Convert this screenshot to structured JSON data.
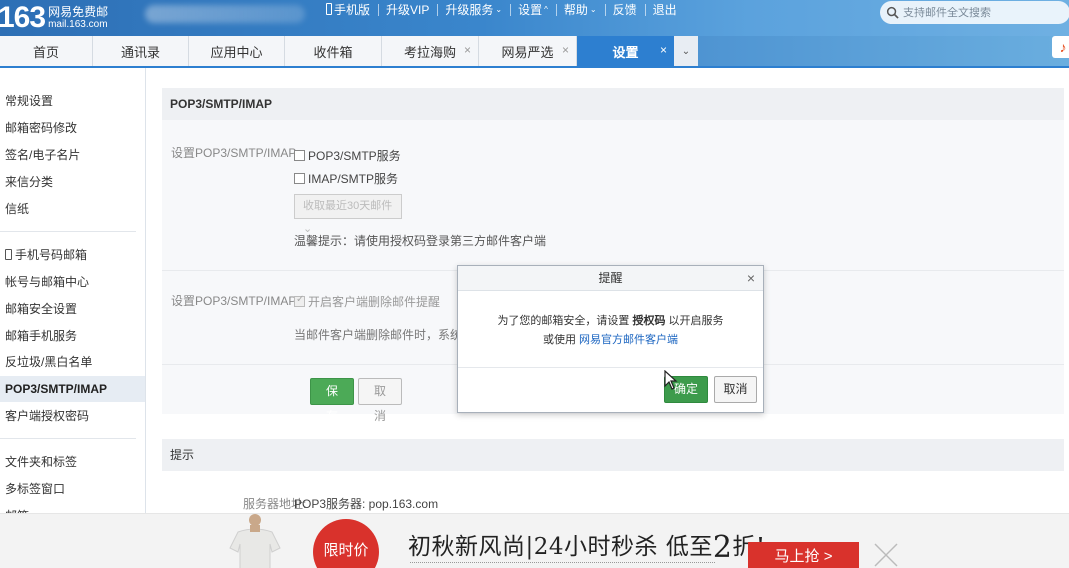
{
  "header": {
    "logo_number": "163",
    "logo_line1": "网易免费邮",
    "logo_line2": "mail.163.com",
    "links": [
      "手机版",
      "升级VIP",
      "升级服务",
      "设置",
      "帮助",
      "反馈",
      "退出"
    ],
    "search_placeholder": "支持邮件全文搜索"
  },
  "tabs": [
    {
      "label": "首页"
    },
    {
      "label": "通讯录"
    },
    {
      "label": "应用中心"
    },
    {
      "label": "收件箱"
    },
    {
      "label": "考拉海购"
    },
    {
      "label": "网易严选"
    },
    {
      "label": "设置"
    }
  ],
  "tab_close_glyph": "×",
  "tab_more_glyph": "⌄",
  "music_glyph": "♪",
  "sidebar": {
    "items": [
      "常规设置",
      "邮箱密码修改",
      "签名/电子名片",
      "来信分类",
      "信纸",
      "手机号码邮箱",
      "帐号与邮箱中心",
      "邮箱安全设置",
      "邮箱手机服务",
      "反垃圾/黑白名单",
      "POP3/SMTP/IMAP",
      "客户端授权密码",
      "文件夹和标签",
      "多标签窗口",
      "邮箱"
    ]
  },
  "main": {
    "section1_title": "POP3/SMTP/IMAP",
    "row1_label": "设置POP3/SMTP/IMAP:",
    "opt_pop3": "POP3/SMTP服务",
    "opt_imap": "IMAP/SMTP服务",
    "select_value": "收取最近30天邮件 ⌄",
    "tip": "温馨提示：请使用授权码登录第三方邮件客户端",
    "row2_label": "设置POP3/SMTP/IMAP:",
    "opt_delete": "开启客户端删除邮件提醒",
    "delete_desc": "当邮件客户端删除邮件时，系统会",
    "save_label": "保存",
    "cancel_label": "取消",
    "section2_title": "提示",
    "server_label": "服务器地址:",
    "server_value": "POP3服务器: pop.163.com"
  },
  "modal": {
    "title": "提醒",
    "close": "×",
    "msg_part1": "为了您的邮箱安全，请设置 ",
    "msg_strong": "授权码",
    "msg_part2": " 以开启服务",
    "msg2_prefix": "或使用 ",
    "msg2_link": "网易官方邮件客户端",
    "ok_label": "确定",
    "cancel_label": "取消"
  },
  "ad": {
    "badge_text": "限时价",
    "slogan_1": "初秋新风尚|24小时秒杀 低至",
    "slogan_big": "2",
    "slogan_2": "折!",
    "buy_label": "马上抢 >"
  },
  "colors": {
    "brand_blue": "#2d7fd0",
    "save_green": "#4caa57",
    "ad_red": "#d9322c",
    "link_blue": "#1a64c0"
  }
}
